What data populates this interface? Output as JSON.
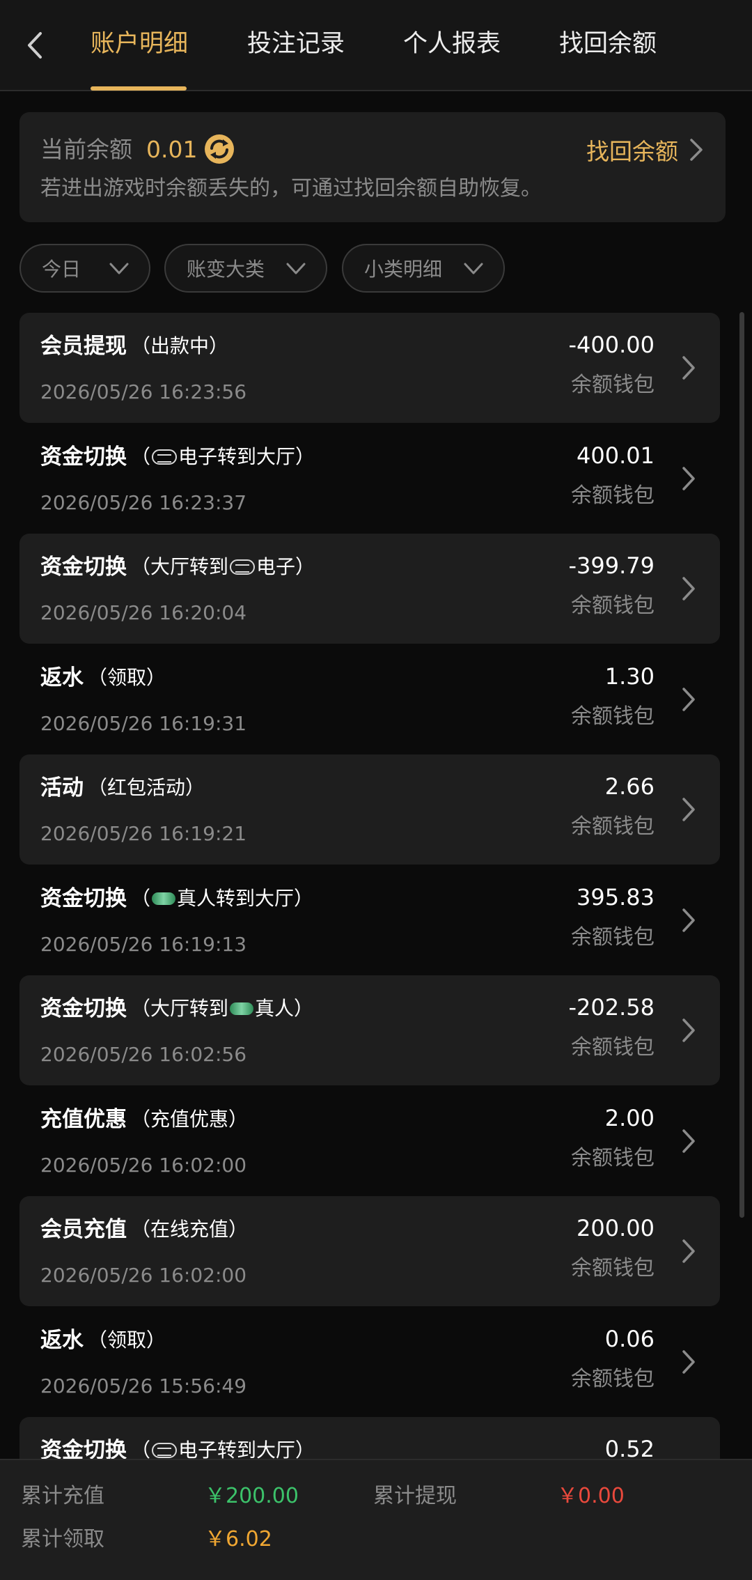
{
  "header": {
    "tabs": [
      {
        "label": "账户明细",
        "active": true
      },
      {
        "label": "投注记录",
        "active": false
      },
      {
        "label": "个人报表",
        "active": false
      },
      {
        "label": "找回余额",
        "active": false
      }
    ],
    "back_icon": "chevron-left-icon"
  },
  "balance": {
    "label": "当前余额",
    "value": "0.01",
    "refresh_icon": "refresh-icon",
    "recover_label": "找回余额",
    "tip": "若进出游戏时余额丢失的，可通过找回余额自助恢复。"
  },
  "filters": [
    {
      "label": "今日"
    },
    {
      "label": "账变大类"
    },
    {
      "label": "小类明细"
    }
  ],
  "transactions": [
    {
      "title": "会员提现",
      "sub_before": "（出款中）",
      "logo": "",
      "sub_after": "",
      "time": "2026/05/26 16:23:56",
      "amount": "-400.00",
      "wallet": "余额钱包"
    },
    {
      "title": "资金切换",
      "sub_before": "（",
      "logo": "pg",
      "sub_after": "电子转到大厅）",
      "time": "2026/05/26 16:23:37",
      "amount": "400.01",
      "wallet": "余额钱包"
    },
    {
      "title": "资金切换",
      "sub_before": "（大厅转到",
      "logo": "pg",
      "sub_after": "电子）",
      "time": "2026/05/26 16:20:04",
      "amount": "-399.79",
      "wallet": "余额钱包"
    },
    {
      "title": "返水",
      "sub_before": "（领取）",
      "logo": "",
      "sub_after": "",
      "time": "2026/05/26 16:19:31",
      "amount": "1.30",
      "wallet": "余额钱包"
    },
    {
      "title": "活动",
      "sub_before": "（红包活动）",
      "logo": "",
      "sub_after": "",
      "time": "2026/05/26 16:19:21",
      "amount": "2.66",
      "wallet": "余额钱包"
    },
    {
      "title": "资金切换",
      "sub_before": "（",
      "logo": "live",
      "sub_after": "真人转到大厅）",
      "time": "2026/05/26 16:19:13",
      "amount": "395.83",
      "wallet": "余额钱包"
    },
    {
      "title": "资金切换",
      "sub_before": "（大厅转到",
      "logo": "live",
      "sub_after": "真人）",
      "time": "2026/05/26 16:02:56",
      "amount": "-202.58",
      "wallet": "余额钱包"
    },
    {
      "title": "充值优惠",
      "sub_before": "（充值优惠）",
      "logo": "",
      "sub_after": "",
      "time": "2026/05/26 16:02:00",
      "amount": "2.00",
      "wallet": "余额钱包"
    },
    {
      "title": "会员充值",
      "sub_before": "（在线充值）",
      "logo": "",
      "sub_after": "",
      "time": "2026/05/26 16:02:00",
      "amount": "200.00",
      "wallet": "余额钱包"
    },
    {
      "title": "返水",
      "sub_before": "（领取）",
      "logo": "",
      "sub_after": "",
      "time": "2026/05/26 15:56:49",
      "amount": "0.06",
      "wallet": "余额钱包"
    },
    {
      "title": "资金切换",
      "sub_before": "（",
      "logo": "pg",
      "sub_after": "电子转到大厅）",
      "time": "",
      "amount": "0.52",
      "wallet": ""
    }
  ],
  "footer": {
    "total_deposit_label": "累计充值",
    "total_deposit_value": "￥200.00",
    "total_withdraw_label": "累计提现",
    "total_withdraw_value": "￥0.00",
    "total_claim_label": "累计领取",
    "total_claim_value": "￥6.02"
  },
  "colors": {
    "accent": "#e7b55b",
    "deposit": "#3cc26a",
    "withdraw": "#e9493c",
    "claim": "#f0a732"
  }
}
